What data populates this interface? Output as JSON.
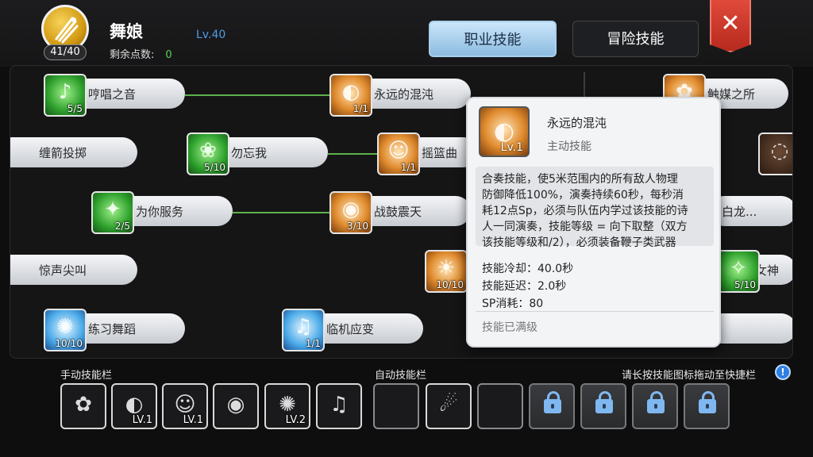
{
  "header": {
    "class_points_badge": "41/40",
    "character_name": "舞娘",
    "level": "Lv.40",
    "remaining_points_label": "剩余点数:",
    "remaining_points_value": "0",
    "tabs": [
      {
        "label": "职业技能",
        "active": true
      },
      {
        "label": "冒险技能",
        "active": false
      }
    ],
    "close_icon": "close-icon"
  },
  "skills": [
    {
      "name": "哼唱之音",
      "level": "5/5",
      "icon": "green"
    },
    {
      "name": "永远的混沌",
      "level": "1/1",
      "icon": "brown"
    },
    {
      "name": "触媒之所",
      "level": "",
      "icon": "brown"
    },
    {
      "name": "缠箭投掷",
      "level": "",
      "icon": "none"
    },
    {
      "name": "勿忘我",
      "level": "5/10",
      "icon": "green"
    },
    {
      "name": "摇篮曲",
      "level": "1/1",
      "icon": "brown"
    },
    {
      "name": "为你服务",
      "level": "2/5",
      "icon": "green"
    },
    {
      "name": "战鼓震天",
      "level": "3/10",
      "icon": "brown"
    },
    {
      "name": "白龙...",
      "level": "",
      "icon": "none"
    },
    {
      "name": "惊声尖叫",
      "level": "",
      "icon": "none"
    },
    {
      "name": "",
      "level": "10/10",
      "icon": "brown"
    },
    {
      "name": "女神",
      "level": "5/10",
      "icon": "green"
    },
    {
      "name": "练习舞蹈",
      "level": "10/10",
      "icon": "blue"
    },
    {
      "name": "临机应变",
      "level": "1/1",
      "icon": "blue"
    },
    {
      "name": "",
      "level": "",
      "icon": "none"
    }
  ],
  "tooltip": {
    "name": "永远的混沌",
    "icon_level": "Lv.1",
    "type": "主动技能",
    "description_lines": [
      "合奏技能，使5米范围内的所有敌人物理",
      "防御降低100%，演奏持续60秒，每秒消",
      "耗12点Sp，必须与队伍内学过该技能的诗",
      "人一同演奏，技能等级 = 向下取整（双方",
      "该技能等级和/2），必须装备鞭子类武器"
    ],
    "cooldown": "技能冷却：40.0秒",
    "delay": "技能延迟：2.0秒",
    "sp_cost": "SP消耗：80",
    "maxed": "技能已满级"
  },
  "bottom": {
    "manual_label": "手动技能栏",
    "auto_label": "自动技能栏",
    "hint": "请长按技能图标拖动至快捷栏",
    "info_icon": "!",
    "manual_slots": [
      {
        "icon": "brown",
        "level": ""
      },
      {
        "icon": "brown",
        "level": "LV.1"
      },
      {
        "icon": "brown",
        "level": "LV.1"
      },
      {
        "icon": "brown",
        "level": ""
      },
      {
        "icon": "blue",
        "level": "LV.2"
      },
      {
        "icon": "blue",
        "level": ""
      }
    ],
    "auto_slots": [
      {
        "state": "empty"
      },
      {
        "state": "filled"
      },
      {
        "state": "empty"
      },
      {
        "state": "locked"
      },
      {
        "state": "locked"
      },
      {
        "state": "locked"
      },
      {
        "state": "locked"
      }
    ]
  }
}
